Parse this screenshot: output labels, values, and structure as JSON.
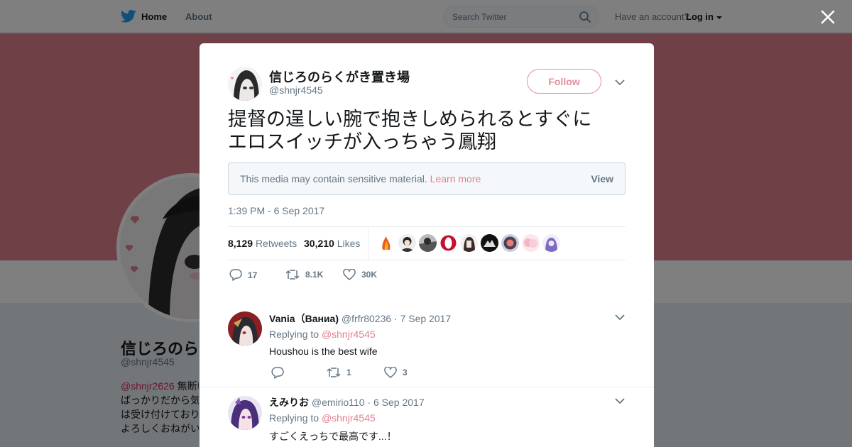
{
  "topnav": {
    "home_label": "Home",
    "about_label": "About",
    "search_placeholder": "Search Twitter",
    "account_prompt": "Have an account?",
    "login_label": "Log in"
  },
  "background_profile": {
    "name": "信じろのらくがき置き場",
    "handle": "@shnjr4545",
    "bio_mention": "@shnjr2626",
    "bio_lines": [
      "無断転載",
      "ばっかりだから気",
      "は受け付けており",
      "よろしくおねがい"
    ]
  },
  "colors": {
    "accent": "#e0808f",
    "banner": "#e0808f",
    "twitter_blue": "#1da1f2"
  },
  "tweet": {
    "author_name": "信じろのらくがき置き場",
    "author_handle": "@shnjr4545",
    "follow_label": "Follow",
    "text_line1": "提督の逞しい腕で抱きしめられるとすぐに",
    "text_line2": "エロスイッチが入っちゃう鳳翔",
    "sensitive_notice": "This media may contain sensitive material.",
    "learn_more_label": "Learn more",
    "view_label": "View",
    "timestamp": "1:39 PM - 6 Sep 2017",
    "retweets_count": "8,129",
    "retweets_label": "Retweets",
    "likes_count": "30,210",
    "likes_label": "Likes",
    "reply_count": "17",
    "retweet_action_count": "8.1K",
    "like_action_count": "30K"
  },
  "replies": [
    {
      "name": "Vania（Ваниа)",
      "handle": "@frfr80236",
      "date": "· 7 Sep 2017",
      "replying_prefix": "Replying to",
      "replying_to": "@shnjr4545",
      "text": "Houshou is the best wife",
      "reply_count": "",
      "retweet_count": "1",
      "like_count": "3"
    },
    {
      "name": "えみりお",
      "handle": "@emirio110",
      "date": "· 6 Sep 2017",
      "replying_prefix": "Replying to",
      "replying_to": "@shnjr4545",
      "text": "すごくえっちで最高です...！"
    }
  ]
}
